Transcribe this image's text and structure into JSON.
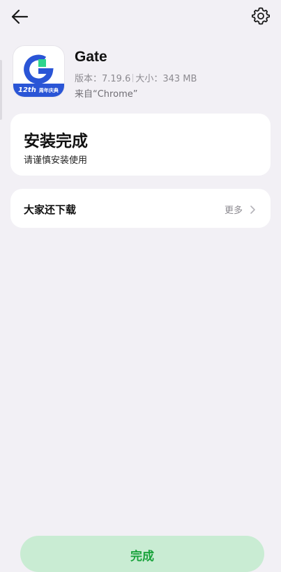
{
  "nav": {
    "back_icon": "back-arrow-icon",
    "settings_icon": "gear-icon"
  },
  "app": {
    "name": "Gate",
    "version_text": "版本：7.19.6",
    "size_text": "大小：343 MB",
    "source_text": "来自“Chrome”",
    "icon": {
      "name": "gate-app-logo",
      "ribbon_number": "12th",
      "ribbon_text": "周年庆典",
      "brand_blue": "#2a55d6",
      "brand_green": "#2ed48e"
    }
  },
  "status_card": {
    "title": "安装完成",
    "subtitle": "请谨慎安装使用"
  },
  "more_card": {
    "title": "大家还下载",
    "link_label": "更多"
  },
  "footer": {
    "done_label": "完成"
  },
  "colors": {
    "background": "#f2f0f5",
    "card": "#ffffff",
    "done_button_bg": "#c9ecd3",
    "done_button_text": "#1aa33c"
  }
}
